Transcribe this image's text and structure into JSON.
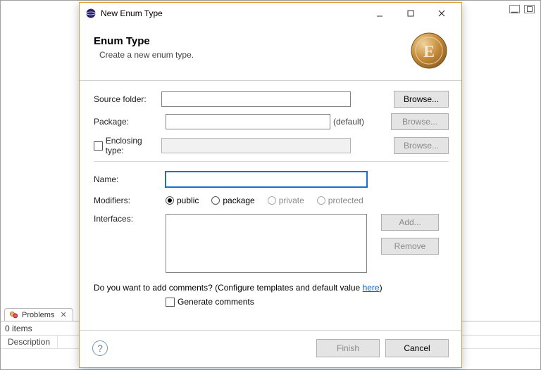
{
  "host": {
    "problems_tab": "Problems",
    "items_count": "0 items",
    "description_header": "Description"
  },
  "dialog": {
    "window_title": "New Enum Type",
    "banner_title": "Enum Type",
    "banner_sub": "Create a new enum type.",
    "labels": {
      "source_folder": "Source folder:",
      "package": "Package:",
      "enclosing_type": "Enclosing type:",
      "name": "Name:",
      "modifiers": "Modifiers:",
      "interfaces": "Interfaces:"
    },
    "buttons": {
      "browse": "Browse...",
      "add": "Add...",
      "remove": "Remove",
      "finish": "Finish",
      "cancel": "Cancel"
    },
    "default_note": "(default)",
    "modifiers_options": {
      "public": "public",
      "package": "package",
      "private": "private",
      "protected": "protected"
    },
    "comments_prompt": "Do you want to add comments? (Configure templates and default value ",
    "comments_link": "here",
    "comments_suffix": ")",
    "generate_comments": "Generate comments",
    "values": {
      "source_folder": "",
      "package": "",
      "enclosing_type": "",
      "name": "",
      "enclosing_checked": false,
      "selected_modifier": "public",
      "generate_comments_checked": false
    }
  }
}
